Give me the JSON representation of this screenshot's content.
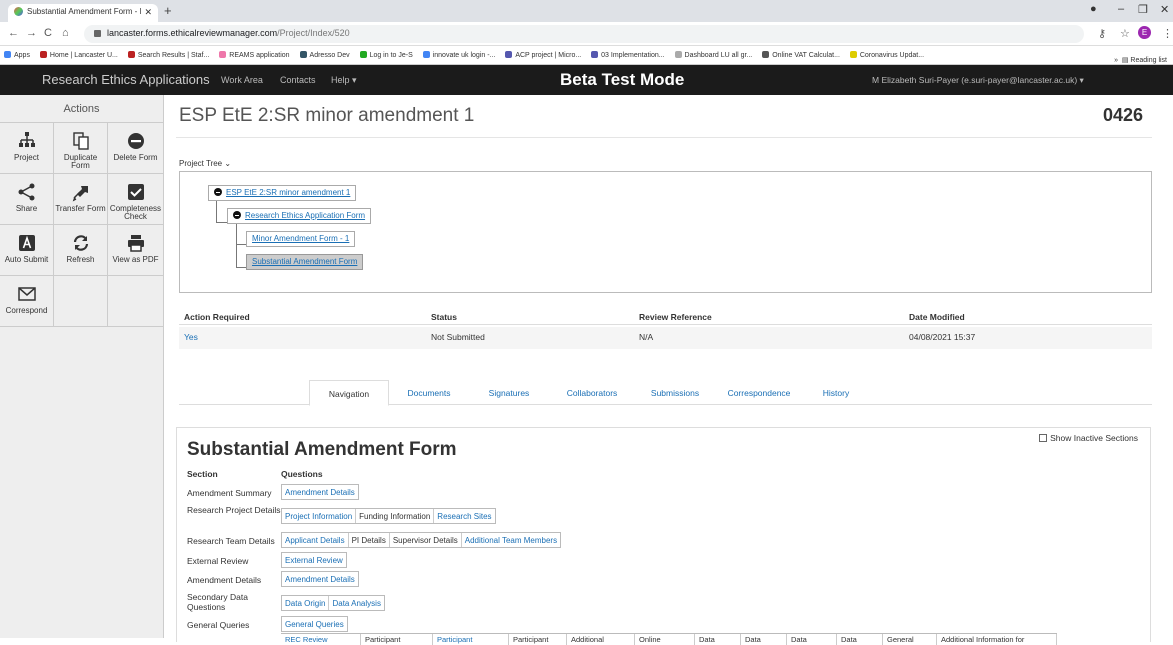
{
  "browser": {
    "tab_title": "Substantial Amendment Form - l",
    "url_host": "lancaster.forms.ethicalreviewmanager.com",
    "url_path": "/Project/Index/520",
    "bookmarks": [
      "Apps",
      "Home | Lancaster U...",
      "Search Results | Staf...",
      "REAMS application",
      "Adresso Dev",
      "Log in to Je-S",
      "innovate uk login -...",
      "ACP project | Micro...",
      "03 Implementation...",
      "Dashboard LU all gr...",
      "Online VAT Calculat...",
      "Coronavirus Updat..."
    ],
    "reading_list": "Reading list",
    "profile_initial": "E"
  },
  "app": {
    "brand": "Research Ethics Applications",
    "nav": [
      "Work Area",
      "Contacts",
      "Help ▾"
    ],
    "mode": "Beta Test Mode",
    "user": "M Elizabeth Suri-Payer (e.suri-payer@lancaster.ac.uk) ▾"
  },
  "sidebar": {
    "header": "Actions",
    "items": [
      {
        "label": "Project",
        "icon": "sitemap-icon"
      },
      {
        "label": "Duplicate Form",
        "icon": "duplicate-icon"
      },
      {
        "label": "Delete Form",
        "icon": "minus-circle-icon"
      },
      {
        "label": "Share",
        "icon": "share-icon"
      },
      {
        "label": "Transfer Form",
        "icon": "transfer-icon"
      },
      {
        "label": "Completeness Check",
        "icon": "check-box-icon"
      },
      {
        "label": "Auto Submit",
        "icon": "auto-submit-icon"
      },
      {
        "label": "Refresh",
        "icon": "refresh-icon"
      },
      {
        "label": "View as PDF",
        "icon": "print-icon"
      },
      {
        "label": "Correspond",
        "icon": "envelope-icon"
      }
    ]
  },
  "project": {
    "title": "ESP EtE 2:SR minor amendment 1",
    "number": "0426",
    "tree_label": "Project Tree ⌄",
    "tree": [
      "ESP EtE 2:SR minor amendment 1",
      "Research Ethics Application Form",
      "Minor Amendment Form - 1",
      "Substantial Amendment Form"
    ]
  },
  "info": {
    "headers": [
      "Action Required",
      "Status",
      "Review Reference",
      "Date Modified"
    ],
    "values": [
      "Yes",
      "Not Submitted",
      "N/A",
      "04/08/2021 15:37"
    ]
  },
  "tabs": [
    "Navigation",
    "Documents",
    "Signatures",
    "Collaborators",
    "Submissions",
    "Correspondence",
    "History"
  ],
  "form": {
    "title": "Substantial Amendment Form",
    "show_inactive": "Show Inactive Sections",
    "col_section": "Section",
    "col_questions": "Questions",
    "sections": [
      {
        "name": "Amendment Summary",
        "questions": [
          {
            "t": "Amendment Details",
            "link": true
          }
        ]
      },
      {
        "name": "Research Project Details",
        "questions": [
          {
            "t": "Project Information",
            "link": true
          },
          {
            "t": "Funding Information",
            "link": false
          },
          {
            "t": "Research Sites",
            "link": true
          }
        ]
      },
      {
        "name": "Research Team Details",
        "questions": [
          {
            "t": "Applicant Details",
            "link": true
          },
          {
            "t": "PI Details",
            "link": false
          },
          {
            "t": "Supervisor Details",
            "link": false
          },
          {
            "t": "Additional Team Members",
            "link": true
          }
        ]
      },
      {
        "name": "External Review",
        "questions": [
          {
            "t": "External Review",
            "link": true
          }
        ]
      },
      {
        "name": "Amendment Details",
        "questions": [
          {
            "t": "Amendment Details",
            "link": true
          }
        ]
      },
      {
        "name": "Secondary Data Questions",
        "questions": [
          {
            "t": "Data Origin",
            "link": true
          },
          {
            "t": "Data Analysis",
            "link": true
          }
        ]
      },
      {
        "name": "General Queries",
        "questions": [
          {
            "t": "General Queries",
            "link": true
          }
        ]
      }
    ],
    "partial_row": [
      "REC Review",
      "Participant",
      "Participant",
      "Participant",
      "Additional",
      "Online",
      "Data",
      "Data",
      "Data",
      "Data",
      "General",
      "Additional Information for"
    ]
  }
}
